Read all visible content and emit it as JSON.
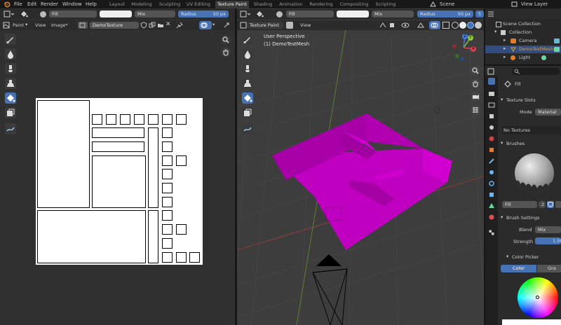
{
  "topbar": {
    "menus": [
      "File",
      "Edit",
      "Render",
      "Window",
      "Help"
    ],
    "workspaces": [
      "Layout",
      "Modeling",
      "Sculpting",
      "UV Editing",
      "Texture Paint",
      "Shading",
      "Animation",
      "Rendering",
      "Compositing",
      "Scripting"
    ],
    "active_workspace": "Texture Paint",
    "scene": "Scene",
    "view_layer": "View Layer"
  },
  "tool_header_left": {
    "brush": "Fill",
    "blend": "Mix",
    "radius_label": "Radius",
    "radius_value": "50 px"
  },
  "tool_header_right": {
    "brush": "Fill",
    "blend": "Mix",
    "radius_label": "Radius",
    "radius_value": "50 px",
    "strength_value": "5"
  },
  "image_editor": {
    "mode": "Paint",
    "view_menu": "View",
    "image_menu": "Image*",
    "image_name": "DemoTexture"
  },
  "viewport": {
    "mode": "Texture Paint",
    "view_menu": "View",
    "perspective": "User Perspective",
    "object_label": "(1) DemoTestMesh",
    "gizmo": {
      "x": "X",
      "y": "Y",
      "z": "Z"
    }
  },
  "outliner": {
    "scene_collection": "Scene Collection",
    "collection": "Collection",
    "items": [
      "Camera",
      "DemoTestMesh",
      "Light"
    ]
  },
  "properties": {
    "tool_name": "Fill",
    "texture_slots_title": "Texture Slots",
    "mode_label": "Mode",
    "mode_value": "Material",
    "no_textures": "No Textures",
    "brushes_title": "Brushes",
    "brush_name": "Fill",
    "brush_users": "2",
    "brush_settings_title": "Brush Settings",
    "blend_label": "Blend",
    "blend_value": "Mix",
    "strength_label": "Strength",
    "strength_value": "1.000",
    "color_picker_title": "Color Picker",
    "color_tab": "Color",
    "gradient_tab": "Gra"
  },
  "colors": {
    "accent": "#4772b3",
    "mesh_magenta": "#c000c0",
    "selected_object": "#e0a030"
  }
}
